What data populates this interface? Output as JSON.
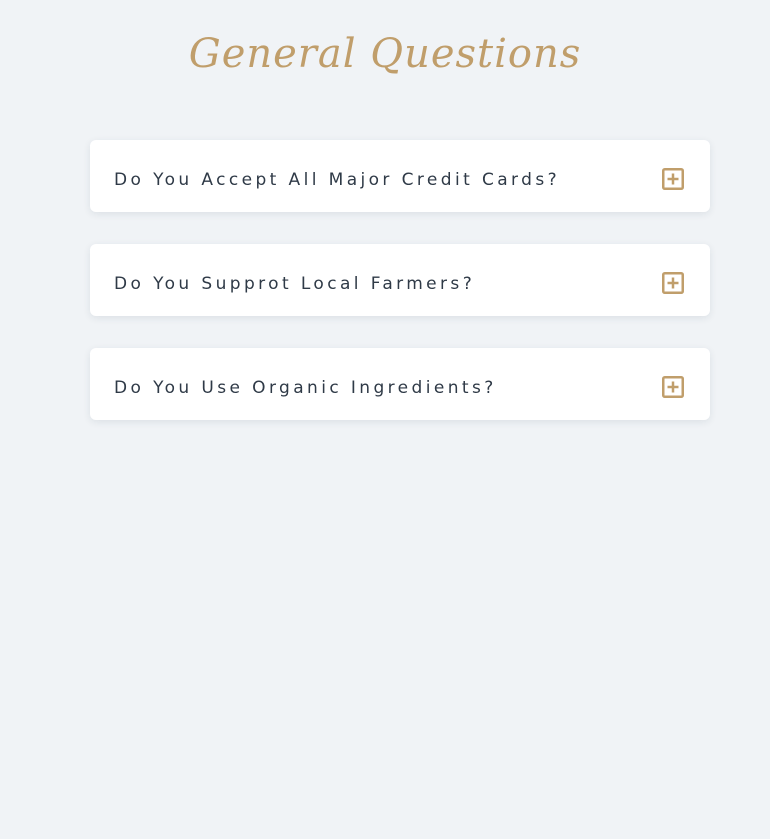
{
  "page": {
    "title": "General Questions"
  },
  "faq": {
    "items": [
      {
        "question": "Do You Accept All Major Credit Cards?",
        "icon": "plus-square-icon"
      },
      {
        "question": "Do You Supprot Local Farmers?",
        "icon": "plus-square-icon"
      },
      {
        "question": "Do You Use Organic Ingredients?",
        "icon": "plus-square-icon"
      }
    ]
  },
  "colors": {
    "background": "#f0f3f6",
    "accent": "#c09e6b",
    "text": "#2f3a47",
    "card": "#ffffff"
  }
}
